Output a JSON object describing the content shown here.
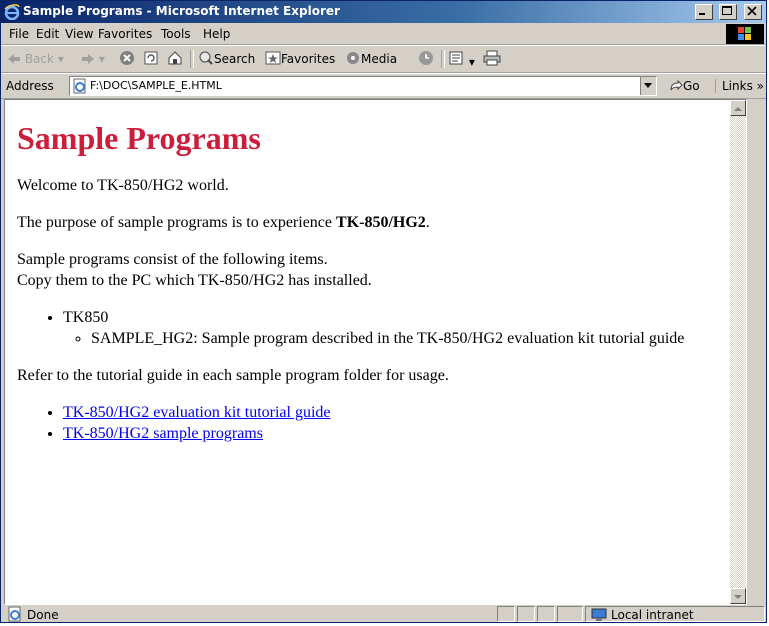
{
  "window": {
    "title": "Sample Programs - Microsoft Internet Explorer"
  },
  "menu": [
    "File",
    "Edit",
    "View",
    "Favorites",
    "Tools",
    "Help"
  ],
  "toolbar": {
    "back": "Back",
    "search": "Search",
    "favorites": "Favorites",
    "media": "Media"
  },
  "address": {
    "label": "Address",
    "url": "F:\\DOC\\SAMPLE_E.HTML",
    "go": "Go",
    "links": "Links"
  },
  "page": {
    "heading": "Sample Programs",
    "welcome": "Welcome to TK-850/HG2 world.",
    "purpose_prefix": "The purpose of sample programs is to experience ",
    "purpose_bold": "TK-850/HG2",
    "purpose_suffix": ".",
    "consist_line1": "Sample programs consist of the following items.",
    "consist_line2": "Copy them to the PC which TK-850/HG2 has installed.",
    "item_top": "TK850",
    "item_sub": "SAMPLE_HG2: Sample program described in the TK-850/HG2 evaluation kit tutorial guide",
    "refer": "Refer to the tutorial guide in each sample program folder for usage.",
    "links": [
      "TK-850/HG2 evaluation kit tutorial guide",
      "TK-850/HG2 sample programs"
    ]
  },
  "status": {
    "text": "Done",
    "zone": "Local intranet"
  },
  "colors": {
    "heading": "#cc1e3c",
    "link": "#0000ee",
    "titlebar": "#0a246a"
  }
}
